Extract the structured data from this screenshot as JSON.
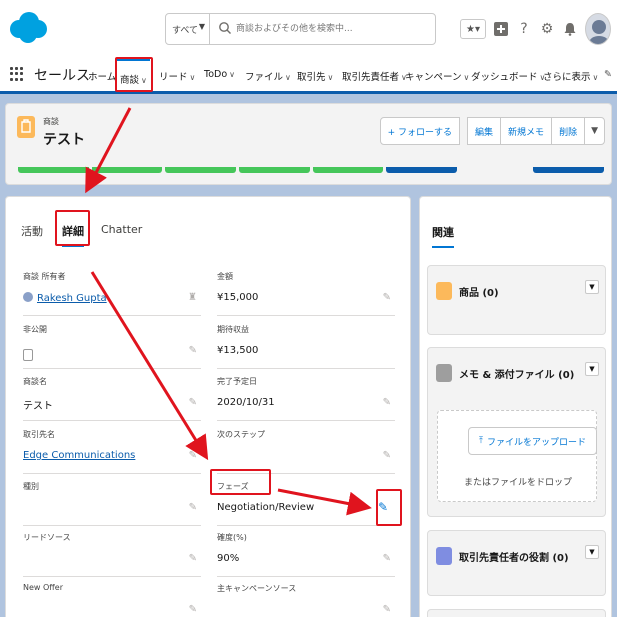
{
  "global_header": {
    "search_scope": "すべて",
    "search_placeholder": "商談およびその他を検索中..."
  },
  "nav": {
    "app_name": "セールス",
    "items": [
      {
        "label": "ホーム",
        "chevron": false
      },
      {
        "label": "商談",
        "chevron": true,
        "active": true
      },
      {
        "label": "リード",
        "chevron": true
      },
      {
        "label": "ToDo",
        "chevron": true
      },
      {
        "label": "ファイル",
        "chevron": true
      },
      {
        "label": "取引先",
        "chevron": true
      },
      {
        "label": "取引先責任者",
        "chevron": true
      },
      {
        "label": "キャンペーン",
        "chevron": true
      },
      {
        "label": "ダッシュボード",
        "chevron": true
      },
      {
        "label": "さらに表示",
        "chevron": true
      }
    ]
  },
  "record": {
    "type_label": "商談",
    "title": "テスト",
    "buttons": {
      "follow": "+ フォローする",
      "edit": "編集",
      "new_note": "新規メモ",
      "delete": "削除"
    }
  },
  "detail": {
    "tabs": [
      "活動",
      "詳細",
      "Chatter"
    ],
    "active_tab": "詳細",
    "fields_left": [
      {
        "label": "商談 所有者",
        "value": "Rakesh Gupta",
        "link": true
      },
      {
        "label": "非公開",
        "value": "",
        "checkbox": true
      },
      {
        "label": "商談名",
        "value": "テスト"
      },
      {
        "label": "取引先名",
        "value": "Edge Communications",
        "link": true
      },
      {
        "label": "種別",
        "value": ""
      },
      {
        "label": "リードソース",
        "value": ""
      },
      {
        "label": "New Offer",
        "value": ""
      }
    ],
    "fields_right": [
      {
        "label": "金額",
        "value": "¥15,000"
      },
      {
        "label": "期待収益",
        "value": "¥13,500"
      },
      {
        "label": "完了予定日",
        "value": "2020/10/31"
      },
      {
        "label": "次のステップ",
        "value": ""
      },
      {
        "label": "フェーズ",
        "value": "Negotiation/Review"
      },
      {
        "label": "確度(%)",
        "value": "90%"
      },
      {
        "label": "主キャンペーンソース",
        "value": ""
      }
    ]
  },
  "related": {
    "title": "関連",
    "items": [
      {
        "label": "商品 (0)",
        "color": "#fcb95b"
      },
      {
        "label": "メモ & 添付ファイル (0)",
        "color": "#9e9e9e"
      },
      {
        "label": "取引先責任者の役割 (0)",
        "color": "#7f8de1"
      }
    ],
    "upload_button": "ファイルをアップロード",
    "drop_text": "またはファイルをドロップ"
  },
  "colors": {
    "brand": "#0176d3",
    "annotation": "#e0141e",
    "path_complete": "#45c65a",
    "path_current": "#0b5cab"
  }
}
